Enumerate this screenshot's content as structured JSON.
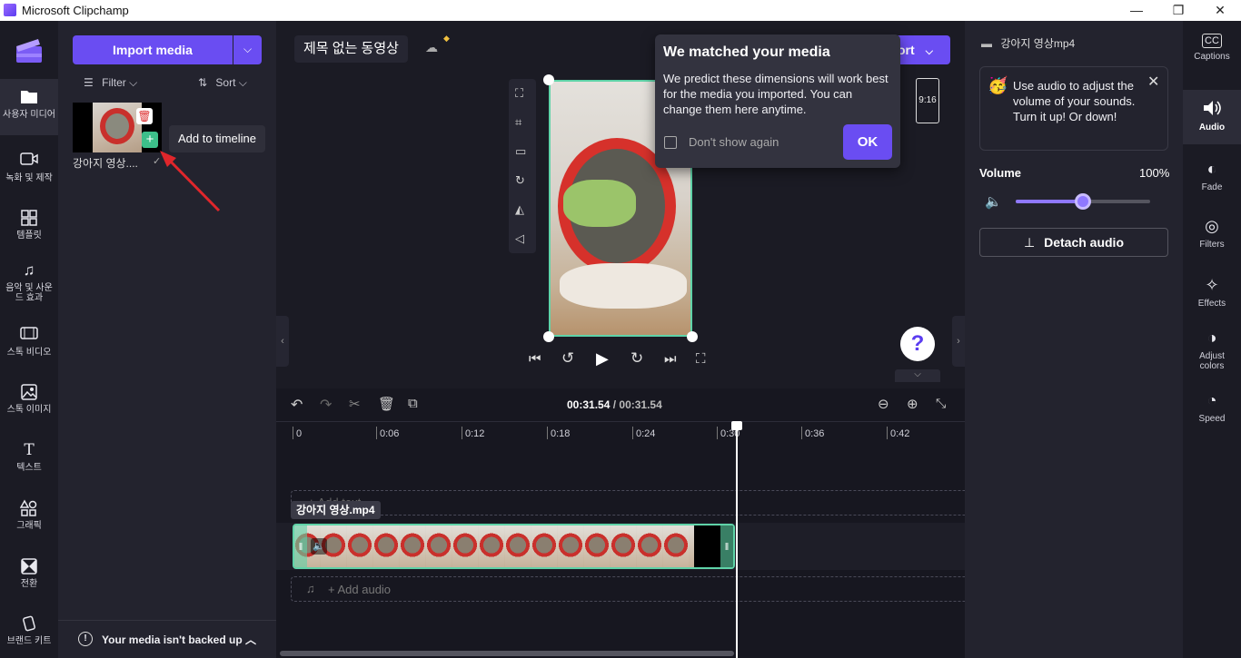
{
  "window": {
    "title": "Microsoft Clipchamp"
  },
  "left_rail": {
    "items": [
      {
        "label": "사용자 미디어",
        "icon": "folder-icon"
      },
      {
        "label": "녹화 및 제작",
        "icon": "camera-icon"
      },
      {
        "label": "템플릿",
        "icon": "templates-icon"
      },
      {
        "label": "음악 및 사운드 효과",
        "icon": "music-icon"
      },
      {
        "label": "스톡 비디오",
        "icon": "stock-video-icon"
      },
      {
        "label": "스톡 이미지",
        "icon": "stock-image-icon"
      },
      {
        "label": "텍스트",
        "icon": "text-icon"
      },
      {
        "label": "그래픽",
        "icon": "graphics-icon"
      },
      {
        "label": "전환",
        "icon": "transitions-icon"
      },
      {
        "label": "브랜드 키트",
        "icon": "brand-kit-icon"
      }
    ]
  },
  "media_panel": {
    "import_label": "Import media",
    "filter_label": "Filter",
    "sort_label": "Sort",
    "media_item_name": "강아지 영상....",
    "add_tooltip": "Add to timeline",
    "backup_notice": "Your media isn't backed up"
  },
  "project": {
    "title": "제목 없는 동영상",
    "export_label": "ort"
  },
  "popup": {
    "title": "We matched your media",
    "body": "We predict these dimensions will work best for the media you imported. You can change them here anytime.",
    "checkbox_label": "Don't show again",
    "ok_label": "OK"
  },
  "aspect_ratio": "9:16",
  "playback": {
    "current": "00:31.54",
    "separator": " / ",
    "total": "00:31.54"
  },
  "ruler": [
    "0",
    "0:06",
    "0:12",
    "0:18",
    "0:24",
    "0:30",
    "0:36",
    "0:42"
  ],
  "timeline": {
    "clip_label": "강아지 영상.mp4",
    "add_audio_label": "+ Add audio",
    "add_text_label": "+ Add text"
  },
  "properties": {
    "file_name": "강아지 영상mp4",
    "tip_text": "Use audio to adjust the volume of your sounds. Turn it up! Or down!",
    "volume_label": "Volume",
    "volume_value": "100%",
    "volume_level": 1.0,
    "detach_label": "Detach audio"
  },
  "right_rail": {
    "items": [
      {
        "label": "Captions",
        "icon": "captions-icon"
      },
      {
        "label": "Audio",
        "icon": "audio-icon"
      },
      {
        "label": "Fade",
        "icon": "fade-icon"
      },
      {
        "label": "Filters",
        "icon": "filters-icon"
      },
      {
        "label": "Effects",
        "icon": "effects-icon"
      },
      {
        "label": "Adjust colors",
        "icon": "adjust-colors-icon"
      },
      {
        "label": "Speed",
        "icon": "speed-icon"
      }
    ]
  },
  "colors": {
    "accent": "#6a4df2",
    "clip_border": "#5fd3a8",
    "add_button": "#3dbf8a",
    "arrow": "#e0262b"
  }
}
